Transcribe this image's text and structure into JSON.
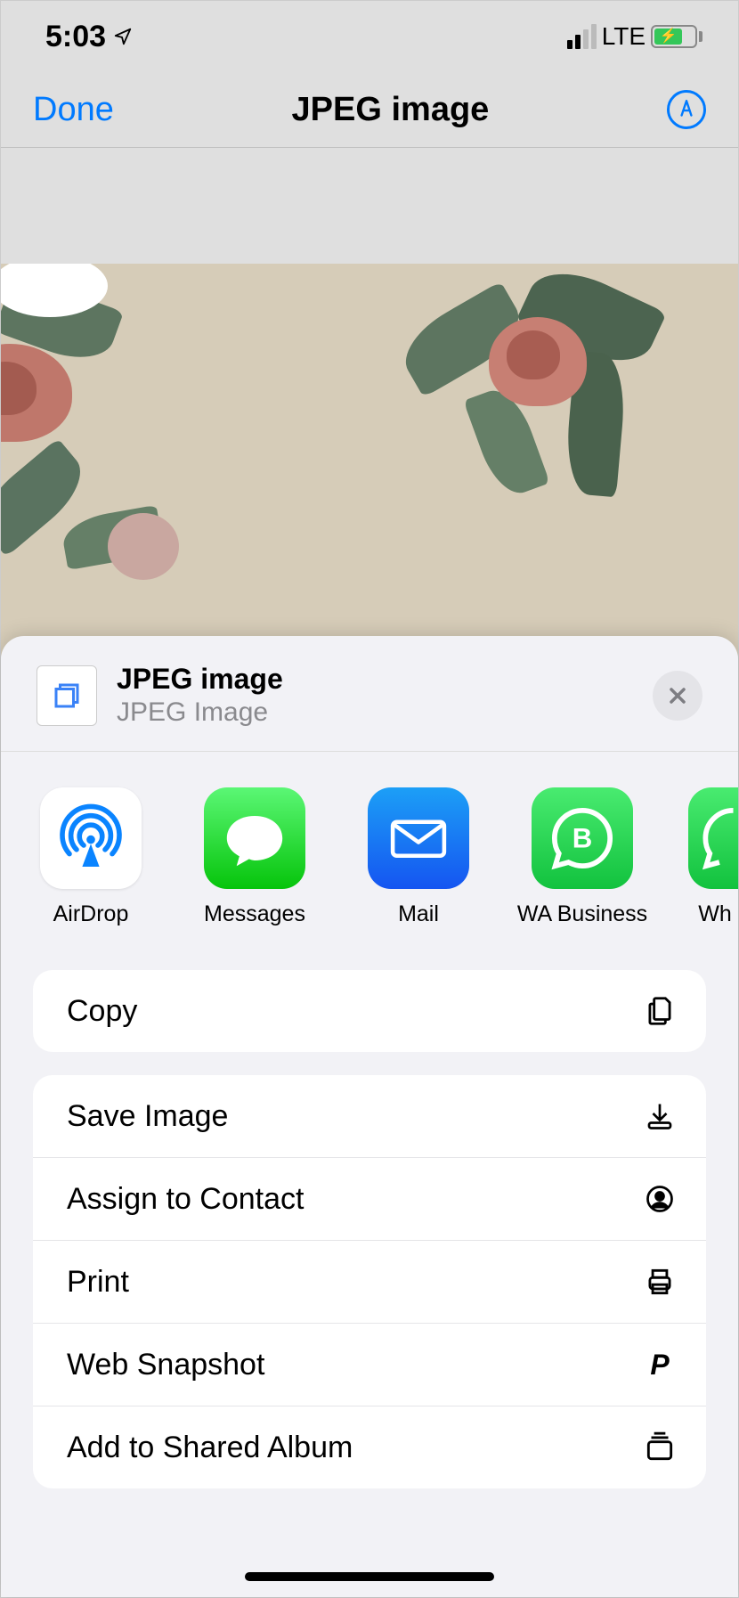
{
  "status": {
    "time": "5:03",
    "network": "LTE"
  },
  "nav": {
    "done": "Done",
    "title": "JPEG image"
  },
  "share": {
    "header": {
      "title": "JPEG image",
      "subtitle": "JPEG Image"
    },
    "apps": [
      {
        "label": "AirDrop"
      },
      {
        "label": "Messages"
      },
      {
        "label": "Mail"
      },
      {
        "label": "WA Business"
      },
      {
        "label": "Wh"
      }
    ],
    "actions_group1": [
      {
        "label": "Copy"
      }
    ],
    "actions_group2": [
      {
        "label": "Save Image"
      },
      {
        "label": "Assign to Contact"
      },
      {
        "label": "Print"
      },
      {
        "label": "Web Snapshot"
      },
      {
        "label": "Add to Shared Album"
      }
    ]
  }
}
